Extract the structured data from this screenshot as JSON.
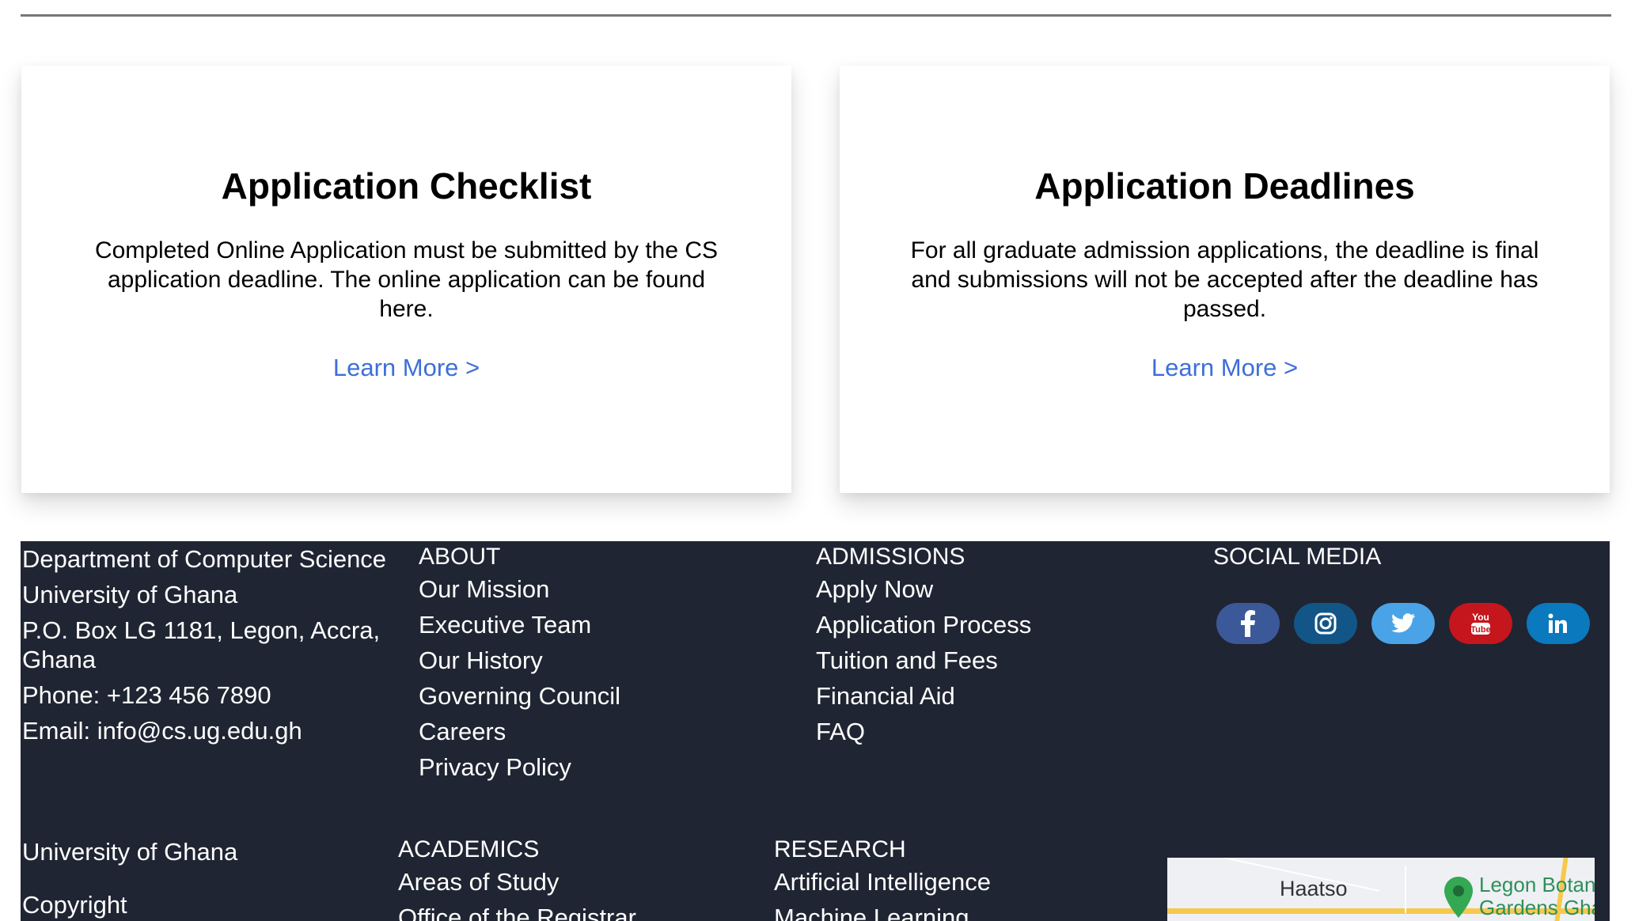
{
  "cards": [
    {
      "title": "Application Checklist",
      "text": "Completed Online Application must be submitted by the CS application deadline. The online application can be found here.",
      "link": "Learn More >"
    },
    {
      "title": "Application Deadlines",
      "text": "For all graduate admission applications, the deadline is final and submissions will not be accepted after the deadline has passed.",
      "link": "Learn More >"
    }
  ],
  "footer": {
    "contact": {
      "dept": "Department of Computer Science",
      "university": "University of Ghana",
      "address": "P.O. Box LG 1181, Legon, Accra, Ghana",
      "phone": "Phone: +123 456 7890",
      "email": "Email: info@cs.ug.edu.gh"
    },
    "about": {
      "heading": "ABOUT",
      "links": [
        "Our Mission",
        "Executive Team",
        "Our History",
        "Governing Council",
        "Careers",
        "Privacy Policy"
      ]
    },
    "admissions": {
      "heading": "ADMISSIONS",
      "links": [
        "Apply Now",
        "Application Process",
        "Tuition and Fees",
        "Financial Aid",
        "FAQ"
      ]
    },
    "social": {
      "heading": "SOCIAL MEDIA",
      "icons": [
        "facebook-icon",
        "instagram-icon",
        "twitter-icon",
        "youtube-icon",
        "linkedin-icon"
      ],
      "colors": [
        "#3b5998",
        "#125688",
        "#4aa3e6",
        "#c4161c",
        "#0a79bd"
      ]
    },
    "bottom": {
      "university": "University of Ghana",
      "copyright": "Copyright",
      "academics": {
        "heading": "ACADEMICS",
        "links": [
          "Areas of Study",
          "Office of the Registrar"
        ]
      },
      "research": {
        "heading": "RESEARCH",
        "links": [
          "Artificial Intelligence",
          "Machine Learning"
        ]
      }
    },
    "map": {
      "place1": "Haatso",
      "place2_line1": "Legon Botanical",
      "place2_line2": "Gardens Ghana"
    }
  },
  "colors": {
    "link": "#3d6fd8",
    "footer_bg": "#1f2532"
  }
}
